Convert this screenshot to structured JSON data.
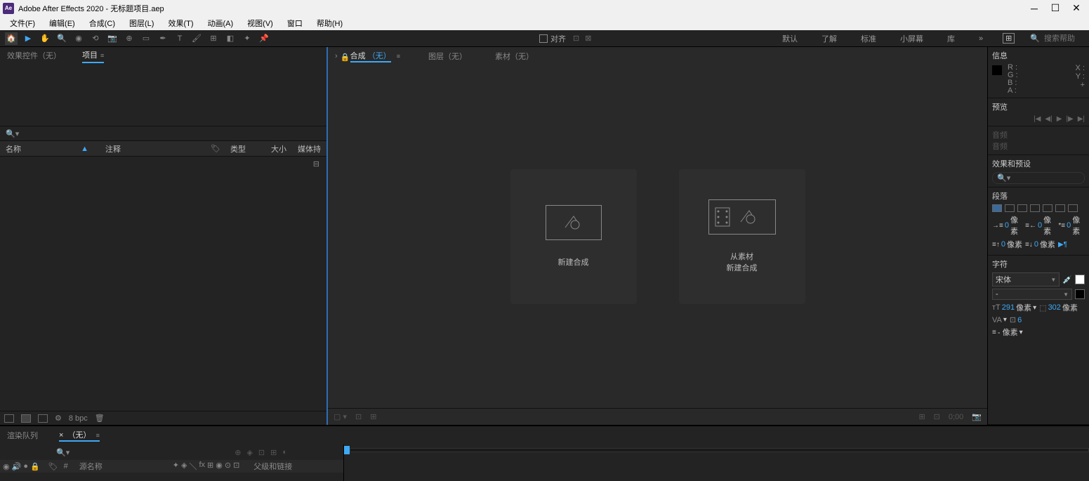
{
  "title": "Adobe After Effects 2020 - 无标题项目.aep",
  "app_icon": "Ae",
  "menu": [
    "文件(F)",
    "编辑(E)",
    "合成(C)",
    "图层(L)",
    "效果(T)",
    "动画(A)",
    "视图(V)",
    "窗口",
    "帮助(H)"
  ],
  "toolbar": {
    "snap_label": "对齐"
  },
  "workspaces": [
    "默认",
    "了解",
    "标准",
    "小屏幕",
    "库"
  ],
  "search_help": "搜索帮助",
  "left": {
    "tabs": {
      "fx_controls": "效果控件（无）",
      "project": "项目"
    },
    "columns": {
      "name": "名称",
      "comment": "注释",
      "type": "类型",
      "size": "大小",
      "media": "媒体持"
    },
    "bpc": "8 bpc"
  },
  "center": {
    "tabs": {
      "comp": "合成",
      "none": "（无）",
      "layer": "图层（无）",
      "footage": "素材（无）"
    },
    "new_comp": "新建合成",
    "from_footage_1": "从素材",
    "from_footage_2": "新建合成"
  },
  "right": {
    "info": {
      "title": "信息",
      "r": "R :",
      "g": "G :",
      "b": "B :",
      "a": "A :",
      "x": "X :",
      "y": "Y :"
    },
    "preview": {
      "title": "预览"
    },
    "audio": {
      "title1": "音频",
      "title2": "音频"
    },
    "fx": {
      "title": "效果和预设"
    },
    "paragraph": {
      "title": "段落",
      "px": "像素",
      "val0": "0"
    },
    "char": {
      "title": "字符",
      "font": "宋体",
      "dash": "-",
      "size": "291",
      "leading": "302",
      "px": "像素",
      "tracking": "6",
      "px_dash": "- 像素"
    }
  },
  "timeline": {
    "tabs": {
      "render": "渲染队列",
      "none": "（无）"
    },
    "cols": {
      "source": "源名称",
      "parent": "父级和链接"
    },
    "num": "#"
  }
}
